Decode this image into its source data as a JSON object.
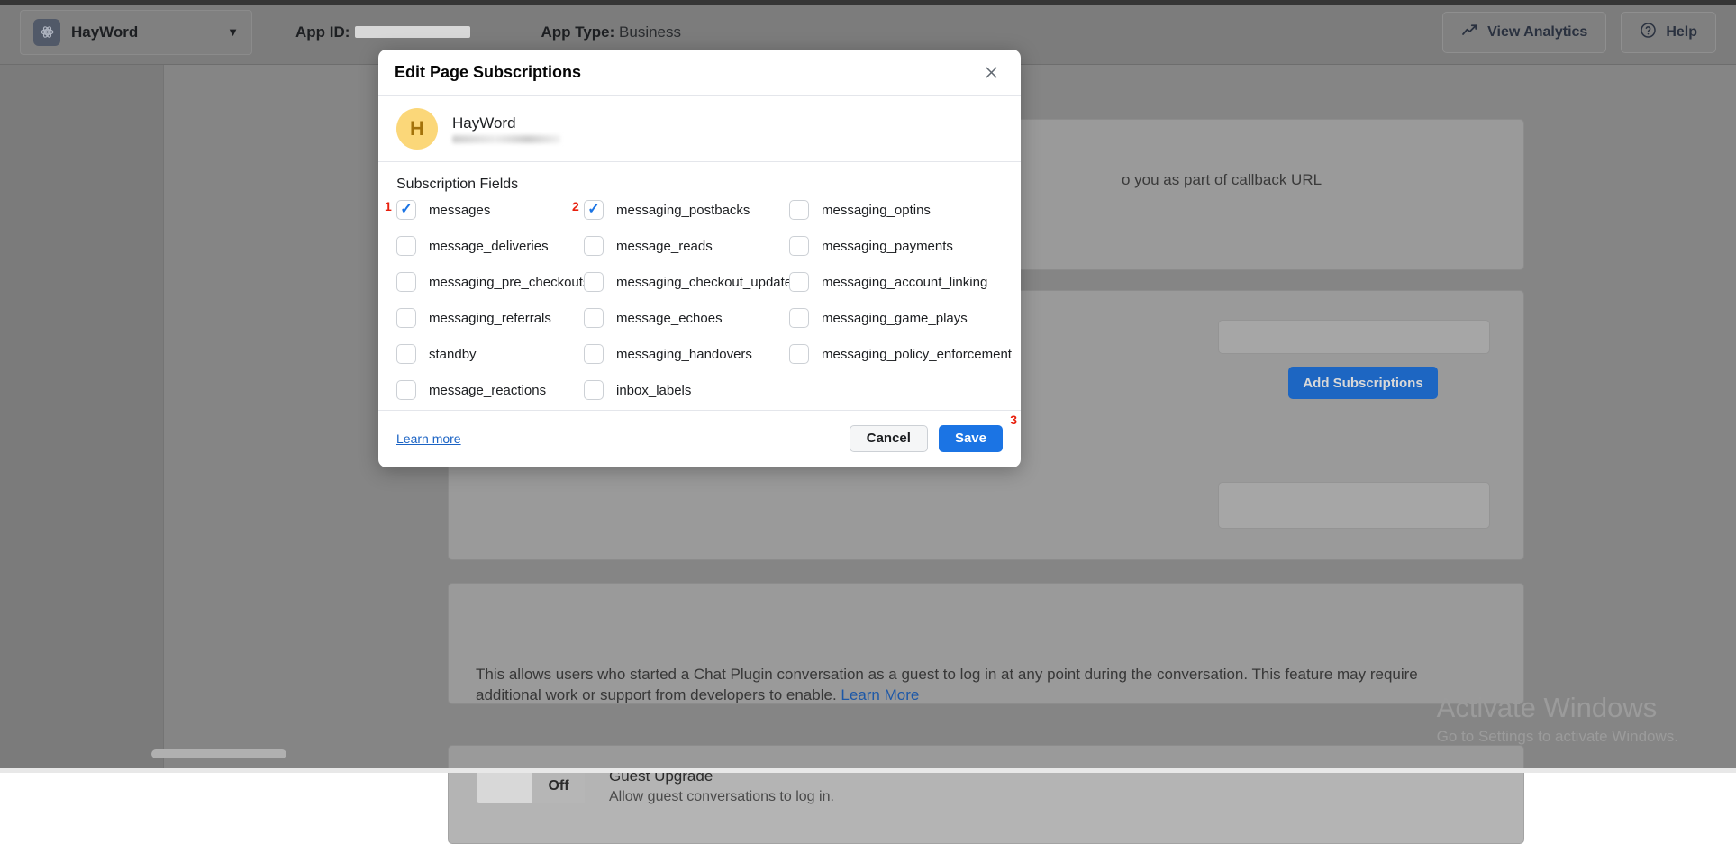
{
  "topbar": {
    "app_name": "HayWord",
    "app_icon": "atom-icon",
    "caret_icon": "chevron-down-icon",
    "app_id_label": "App ID:",
    "app_id_value": "",
    "app_type_label": "App Type:",
    "app_type_value": "Business",
    "view_analytics": "View Analytics",
    "analytics_icon": "trending-up-icon",
    "help": "Help",
    "help_icon": "question-circle-icon"
  },
  "background": {
    "callback_text": "o you as part of callback URL",
    "add_subscriptions": "Add Subscriptions",
    "guest_login_text": "This allows users who started a Chat Plugin conversation as a guest to log in at any point during the conversation. This feature may require additional work or support from developers to enable.",
    "guest_login_link": "Learn More",
    "toggle_state": "Off",
    "guest_upgrade_title": "Guest Upgrade",
    "guest_upgrade_sub": "Allow guest conversations to log in.",
    "watermark_line1": "Activate Windows",
    "watermark_line2": "Go to Settings to activate Windows."
  },
  "modal": {
    "title": "Edit Page Subscriptions",
    "close_icon": "close-icon",
    "page_avatar_letter": "H",
    "page_name": "HayWord",
    "section_title": "Subscription Fields",
    "fields": [
      {
        "label": "messages",
        "checked": true,
        "annotation": "1"
      },
      {
        "label": "messaging_postbacks",
        "checked": true,
        "annotation": "2"
      },
      {
        "label": "messaging_optins",
        "checked": false,
        "annotation": ""
      },
      {
        "label": "message_deliveries",
        "checked": false,
        "annotation": ""
      },
      {
        "label": "message_reads",
        "checked": false,
        "annotation": ""
      },
      {
        "label": "messaging_payments",
        "checked": false,
        "annotation": ""
      },
      {
        "label": "messaging_pre_checkouts",
        "checked": false,
        "annotation": ""
      },
      {
        "label": "messaging_checkout_updates",
        "checked": false,
        "annotation": ""
      },
      {
        "label": "messaging_account_linking",
        "checked": false,
        "annotation": ""
      },
      {
        "label": "messaging_referrals",
        "checked": false,
        "annotation": ""
      },
      {
        "label": "message_echoes",
        "checked": false,
        "annotation": ""
      },
      {
        "label": "messaging_game_plays",
        "checked": false,
        "annotation": ""
      },
      {
        "label": "standby",
        "checked": false,
        "annotation": ""
      },
      {
        "label": "messaging_handovers",
        "checked": false,
        "annotation": ""
      },
      {
        "label": "messaging_policy_enforcement",
        "checked": false,
        "annotation": ""
      },
      {
        "label": "message_reactions",
        "checked": false,
        "annotation": ""
      },
      {
        "label": "inbox_labels",
        "checked": false,
        "annotation": ""
      },
      {
        "label": "",
        "checked": false,
        "annotation": ""
      }
    ],
    "learn_more": "Learn more",
    "cancel": "Cancel",
    "save": "Save",
    "save_annotation": "3"
  },
  "colors": {
    "accent_blue": "#1b74e4",
    "annotation_red": "#e8200e",
    "avatar_yellow": "#fbd779"
  }
}
